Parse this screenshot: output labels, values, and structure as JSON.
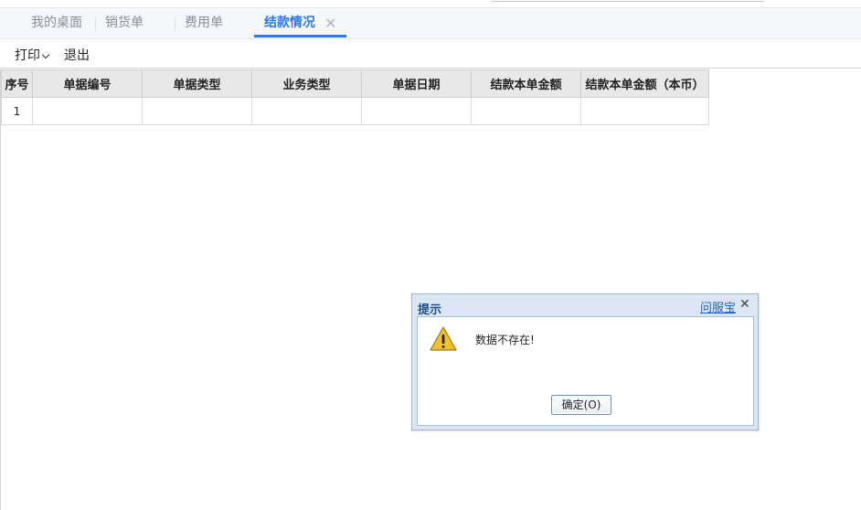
{
  "tabs": [
    {
      "label": "我的桌面"
    },
    {
      "label": "销货单"
    },
    {
      "label": "费用单"
    },
    {
      "label": "结款情况",
      "active": true
    }
  ],
  "toolbar": {
    "print_label": "打印",
    "exit_label": "退出"
  },
  "table": {
    "columns": [
      "序号",
      "单据编号",
      "单据类型",
      "业务类型",
      "单据日期",
      "结款本单金额",
      "结款本单金额（本币）"
    ],
    "rows": [
      [
        "1",
        "",
        "",
        "",
        "",
        "",
        ""
      ]
    ]
  },
  "dialog": {
    "title": "提示",
    "help_link": "问服宝",
    "message": "数据不存在!",
    "ok_label": "确定(O)"
  },
  "icons": {
    "tab_close": "close-icon",
    "print_menu": "chevron-down-icon",
    "dialog_close": "close-icon",
    "message_icon": "warning-icon"
  },
  "colors": {
    "accent": "#2c7be5",
    "dialog_title": "#1c4f8c",
    "link": "#1b62c8",
    "warning": "#f2c12e"
  }
}
